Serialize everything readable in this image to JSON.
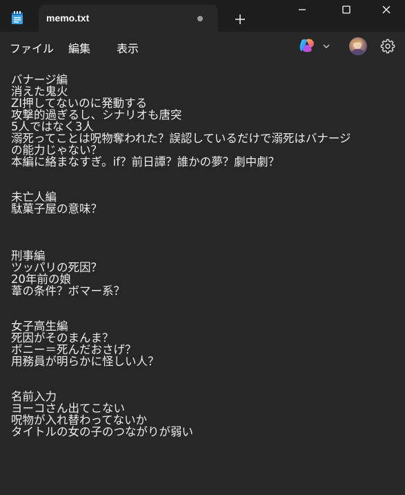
{
  "window": {
    "tab_title": "memo.txt",
    "new_tab_symbol": "+"
  },
  "menu": {
    "file": "ファイル",
    "edit": "編集",
    "view": "表示"
  },
  "icons": {
    "app": "notepad-icon",
    "copilot": "copilot-icon",
    "account": "avatar",
    "settings": "gear-icon"
  },
  "colors": {
    "titlebar": "#1d1d1d",
    "editor_bg": "#272727",
    "text": "#ececec",
    "app_icon": "#3aa0e8"
  },
  "document": {
    "lines": [
      "バナージ編",
      "消えた鬼火",
      "ZI押してないのに発動する",
      "攻撃的過ぎるし、シナリオも唐突",
      "5人ではなく3人",
      "溺死ってことは呪物奪われた？誤認しているだけで溺死はバナージ",
      "の能力じゃない？",
      "本編に絡まなすぎ。if？前日譚？誰かの夢？劇中劇？",
      "",
      "",
      "未亡人編",
      "駄菓子屋の意味？",
      "",
      "",
      "",
      "刑事編",
      "ツッパリの死因？",
      "20年前の娘",
      "葦の条件？ボマー系？",
      "",
      "",
      "女子高生編",
      "死因がそのまんま？",
      "ボニー＝死んだおさげ？",
      "用務員が明らかに怪しい人？",
      "",
      "",
      "名前入力",
      "ヨーコさん出てこない",
      "呪物が入れ替わってないか",
      "タイトルの女の子のつながりが弱い"
    ]
  }
}
